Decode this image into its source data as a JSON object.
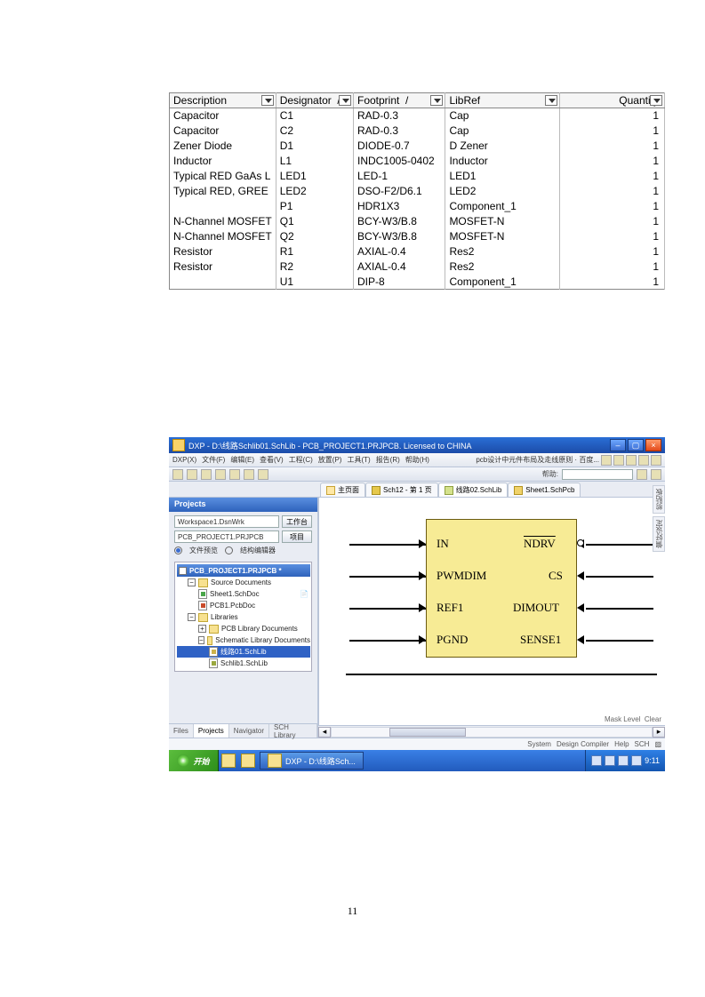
{
  "page": {
    "number": "11"
  },
  "bom": {
    "headers": [
      "Description",
      "Designator",
      "Footprint",
      "LibRef",
      "Quantity"
    ],
    "rows": [
      [
        "Capacitor",
        "C1",
        "RAD-0.3",
        "Cap",
        "1"
      ],
      [
        "Capacitor",
        "C2",
        "RAD-0.3",
        "Cap",
        "1"
      ],
      [
        "Zener Diode",
        "D1",
        "DIODE-0.7",
        "D Zener",
        "1"
      ],
      [
        "Inductor",
        "L1",
        "INDC1005-0402",
        "Inductor",
        "1"
      ],
      [
        "Typical RED GaAs L",
        "LED1",
        "LED-1",
        "LED1",
        "1"
      ],
      [
        "Typical RED, GREE",
        "LED2",
        "DSO-F2/D6.1",
        "LED2",
        "1"
      ],
      [
        "",
        "P1",
        "HDR1X3",
        "Component_1",
        "1"
      ],
      [
        "N-Channel MOSFET",
        "Q1",
        "BCY-W3/B.8",
        "MOSFET-N",
        "1"
      ],
      [
        "N-Channel MOSFET",
        "Q2",
        "BCY-W3/B.8",
        "MOSFET-N",
        "1"
      ],
      [
        "Resistor",
        "R1",
        "AXIAL-0.4",
        "Res2",
        "1"
      ],
      [
        "Resistor",
        "R2",
        "AXIAL-0.4",
        "Res2",
        "1"
      ],
      [
        "",
        "U1",
        "DIP-8",
        "Component_1",
        "1"
      ]
    ]
  },
  "app": {
    "title": "DXP - D:\\线路Schlib01.SchLib - PCB_PROJECT1.PRJPCB. Licensed to CHINA",
    "menu": [
      "DXP(X)",
      "文件(F)",
      "编辑(E)",
      "查看(V)",
      "工程(C)",
      "放置(P)",
      "工具(T)",
      "报告(R)",
      "帮助(H)"
    ],
    "searchLabel": "帮助:",
    "docTabs": [
      {
        "icon": "home",
        "label": "主页面"
      },
      {
        "icon": "sch",
        "label": "Sch12 - 第 1 页"
      },
      {
        "icon": "libsch",
        "label": "线路02.SchLib",
        "active": true
      },
      {
        "icon": "sheet",
        "label": "Sheet1.SchPcb"
      }
    ],
    "panel": {
      "title": "Projects",
      "workspace": "Workspace1.DsnWrk",
      "wsBtn": "工作台",
      "project": "PCB_PROJECT1.PRJPCB",
      "prjBtn": "项目",
      "radio1": "文件预览",
      "radio2": "结构编辑器",
      "tree": {
        "root": "PCB_PROJECT1.PRJPCB *",
        "n_src": "Source Documents",
        "n_sch": "Sheet1.SchDoc",
        "n_pcb": "PCB1.PcbDoc",
        "n_libs": "Libraries",
        "n_pcblib": "PCB Library Documents",
        "n_schlib": "Schematic Library Documents",
        "n_sel": "线路01.SchLib",
        "n_sch2": "Schlib1.SchLib"
      },
      "bottomTabs": [
        "Files",
        "Projects",
        "Navigator",
        "SCH Library"
      ]
    },
    "chip": {
      "left": [
        "IN",
        "PWMDIM",
        "REF1",
        "PGND"
      ],
      "right": [
        "NDRV",
        "CS",
        "DIMOUT",
        "SENSE1"
      ],
      "rightBar": [
        true,
        false,
        false,
        false
      ]
    },
    "status": {
      "rightTabs": [
        "System",
        "Design Compiler",
        "Help",
        "SCH"
      ],
      "corner": [
        "Mask Level",
        "Clear"
      ]
    },
    "sideTabs": [
      "剪贴板",
      "偏好设定"
    ],
    "taskbar": {
      "start": "开始",
      "task": "DXP - D:\\线路Sch...",
      "time": "9:11"
    }
  }
}
